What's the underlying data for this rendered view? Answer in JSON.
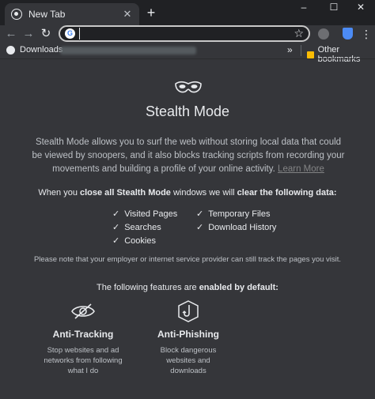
{
  "tab": {
    "title": "New Tab",
    "favicon": "globe-icon",
    "close_icon": "close-icon"
  },
  "window_controls": {
    "minimize": "–",
    "maximize": "☐",
    "close": "✕"
  },
  "toolbar": {
    "back": "←",
    "forward": "→",
    "reload": "↻",
    "omnibox_value": "",
    "star": "☆",
    "menu": "⋮",
    "new_tab": "+"
  },
  "bookmarks": {
    "downloads": "Downloads",
    "more": "»",
    "other": "Other bookmarks"
  },
  "page": {
    "title": "Stealth Mode",
    "description": "Stealth Mode allows you to surf the web without storing local data that could be viewed by snoopers, and it also blocks tracking scripts from recording your movements and building a profile of your online activity.",
    "learn_more": "Learn More",
    "clear_pre": "When you ",
    "clear_bold1": "close all Stealth Mode",
    "clear_mid": " windows we will ",
    "clear_bold2": "clear the following data:",
    "cleared_items": [
      "Visited Pages",
      "Temporary Files",
      "Searches",
      "Download History",
      "Cookies"
    ],
    "note": "Please note that your employer or internet service provider can still track the pages you visit.",
    "features_pre": "The following features are ",
    "features_bold": "enabled by default:",
    "features": [
      {
        "title": "Anti-Tracking",
        "desc_lines": [
          "Stop websites and ad",
          "networks from following",
          "what I do"
        ]
      },
      {
        "title": "Anti-Phishing",
        "desc_lines": [
          "Block dangerous",
          "websites and",
          "downloads"
        ]
      }
    ]
  },
  "colors": {
    "background": "#35363a",
    "titlebar": "#202124",
    "text": "#e8eaed"
  }
}
